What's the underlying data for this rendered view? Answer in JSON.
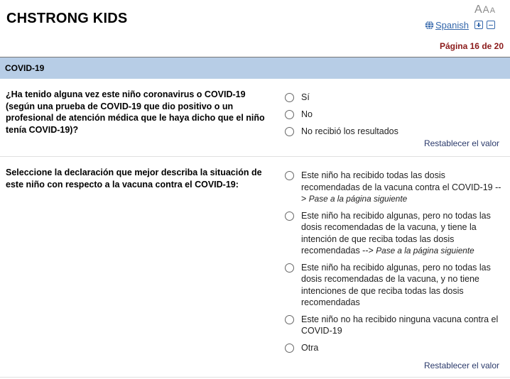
{
  "header": {
    "title": "CHSTRONG KIDS",
    "font_size_labels": [
      "A",
      "A",
      "A"
    ],
    "language_link": "Spanish",
    "page_indicator": "Página 16 de 20"
  },
  "section": {
    "title": "COVID-19"
  },
  "questions": [
    {
      "label": "¿Ha tenido alguna vez este niño coronavirus o COVID-19 (según una prueba de COVID-19 que dio positivo o un profesional de atención médica que le haya dicho que el niño tenía COVID-19)?",
      "choices": [
        {
          "label": "Sí",
          "note": ""
        },
        {
          "label": "No",
          "note": ""
        },
        {
          "label": "No recibió los resultados",
          "note": ""
        }
      ],
      "reset_label": "Restablecer el valor"
    },
    {
      "label": "Seleccione la declaración que mejor describa la situación de este niño con respecto a la vacuna contra el COVID-19:",
      "choices": [
        {
          "label": "Este niño ha recibido todas las dosis recomendadas de la vacuna contra el COVID-19 --> ",
          "note": "Pase a la página siguiente"
        },
        {
          "label": "Este niño ha recibido algunas, pero no todas las dosis recomendadas de la vacuna, y tiene la intención de que reciba todas las dosis recomendadas --> ",
          "note": "Pase a la página siguiente"
        },
        {
          "label": "Este niño ha recibido algunas, pero no todas las dosis recomendadas de la vacuna, y no tiene intenciones de que reciba todas las dosis recomendadas",
          "note": ""
        },
        {
          "label": "Este niño no ha recibido ninguna vacuna contra el COVID-19",
          "note": ""
        },
        {
          "label": "Otra",
          "note": ""
        }
      ],
      "reset_label": "Restablecer el valor"
    }
  ],
  "colors": {
    "section_bar": "#b7cde6",
    "page_indicator": "#8b1a1a",
    "link": "#3366aa"
  },
  "icons": [
    "globe-icon",
    "zoom-in-icon",
    "zoom-out-icon",
    "radio-icon"
  ]
}
